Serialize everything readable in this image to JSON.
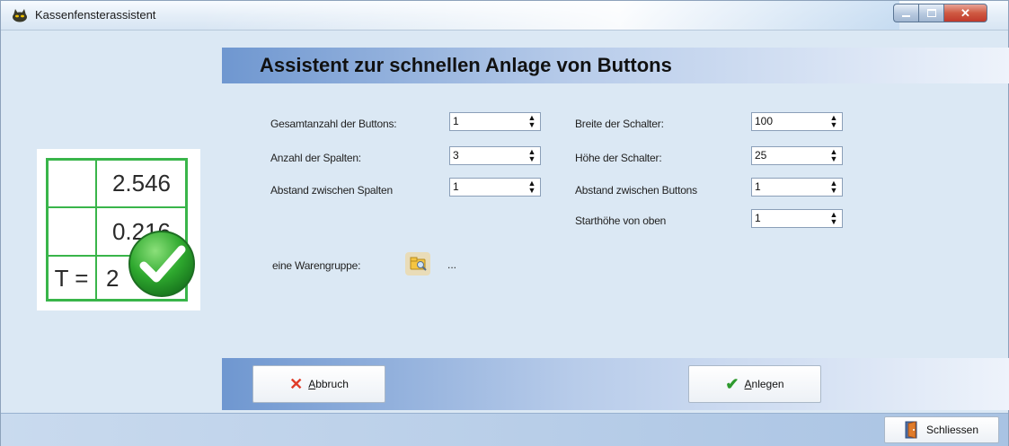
{
  "window": {
    "title": "Kassenfensterassistent"
  },
  "header": {
    "title": "Assistent zur schnellen Anlage von Buttons"
  },
  "image": {
    "cells": [
      "2.546",
      "0.216",
      "T =",
      "2"
    ]
  },
  "form": {
    "left": [
      {
        "label": "Gesamtanzahl der Buttons:",
        "value": "1"
      },
      {
        "label": "Anzahl der Spalten:",
        "value": "3"
      },
      {
        "label": "Abstand zwischen Spalten",
        "value": "1"
      }
    ],
    "right": [
      {
        "label": "Breite der Schalter:",
        "value": "100"
      },
      {
        "label": "Höhe der Schalter:",
        "value": "25"
      },
      {
        "label": "Abstand zwischen Buttons",
        "value": "1"
      },
      {
        "label": "Starthöhe von oben",
        "value": "1"
      }
    ],
    "warengruppe": {
      "label": "eine Warengruppe:",
      "value": "..."
    }
  },
  "buttons": {
    "cancel": {
      "mnemonic": "A",
      "rest": "bbruch"
    },
    "create": {
      "mnemonic": "A",
      "rest": "nlegen"
    },
    "close": "Schliessen"
  },
  "colors": {
    "check_green": "#39b54a",
    "header_blue": "#6f97d0"
  }
}
